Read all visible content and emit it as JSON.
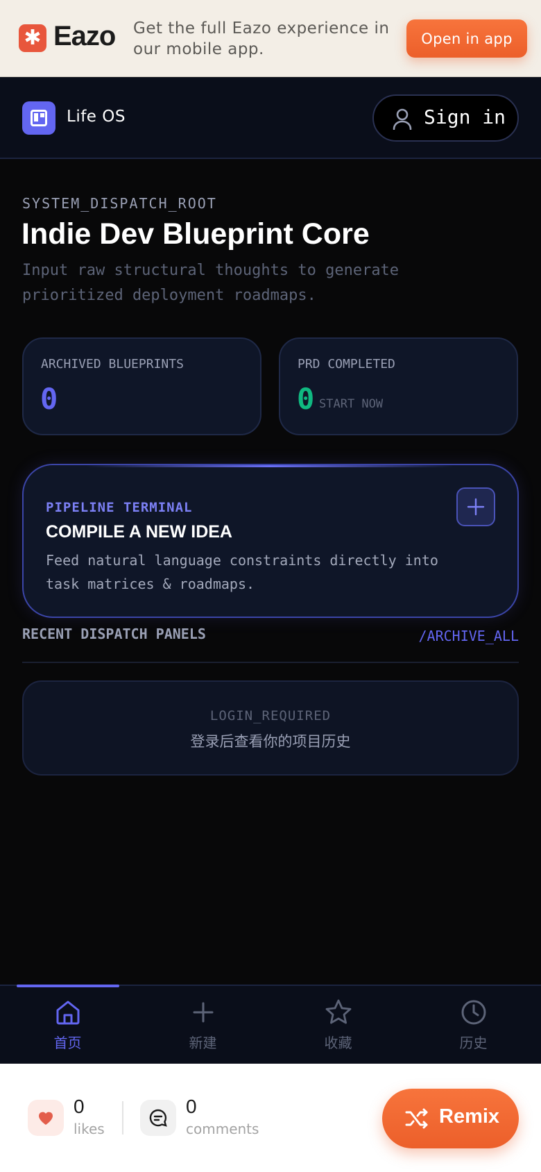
{
  "promo": {
    "brand": "Eazo",
    "logo_glyph": "✱",
    "tagline": "Get the full Eazo experience in our mobile app.",
    "open_label": "Open in app"
  },
  "header": {
    "app_name": "Life OS",
    "sign_in_label": "Sign in"
  },
  "main": {
    "system_label": "SYSTEM_DISPATCH_ROOT",
    "title": "Indie Dev Blueprint Core",
    "subtitle": "Input raw structural thoughts to generate prioritized deployment roadmaps.",
    "stats": [
      {
        "caption": "ARCHIVED BLUEPRINTS",
        "value": "0",
        "hint": ""
      },
      {
        "caption": "PRD COMPLETED",
        "value": "0",
        "hint": "START NOW"
      }
    ],
    "pipeline": {
      "kicker": "PIPELINE TERMINAL",
      "heading": "COMPILE A NEW IDEA",
      "description": "Feed natural language constraints directly into task matrices & roadmaps."
    },
    "recent": {
      "heading": "RECENT DISPATCH PANELS",
      "archive_link": "/ARCHIVE_ALL",
      "empty_code": "LOGIN_REQUIRED",
      "empty_message": "登录后查看你的项目历史"
    }
  },
  "tabs": [
    {
      "label": "首页",
      "icon": "home-icon",
      "active": true
    },
    {
      "label": "新建",
      "icon": "plus-icon",
      "active": false
    },
    {
      "label": "收藏",
      "icon": "star-icon",
      "active": false
    },
    {
      "label": "历史",
      "icon": "clock-icon",
      "active": false
    }
  ],
  "footer": {
    "likes_count": "0",
    "likes_label": "likes",
    "comments_count": "0",
    "comments_label": "comments",
    "remix_label": "Remix"
  },
  "colors": {
    "accent": "#6366f1",
    "success": "#10b981",
    "brand_orange": "#f0682f",
    "background": "#080809"
  }
}
